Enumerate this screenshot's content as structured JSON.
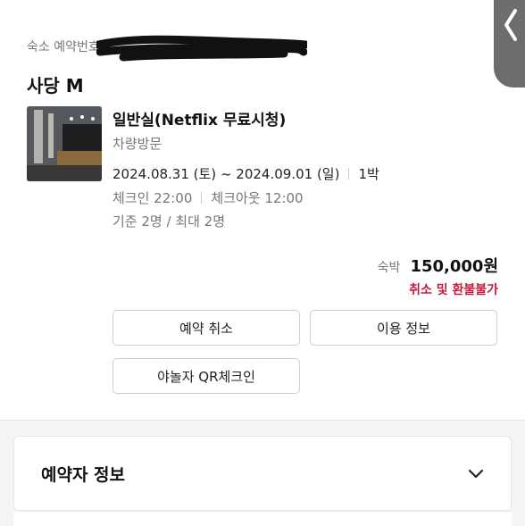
{
  "reservation": {
    "number_label": "숙소 예약번호",
    "hotel_name": "사당 M",
    "room_name": "일반실(Netflix 무료시청)",
    "visit_type": "차량방문",
    "checkin_date": "2024.08.31 (토)",
    "date_separator": "~",
    "checkout_date": "2024.09.01 (일)",
    "nights": "1박",
    "checkin_time": "체크인 22:00",
    "checkout_time": "체크아웃 12:00",
    "capacity": "기준 2명 / 최대 2명",
    "price_label": "숙박",
    "price": "150,000원",
    "cancel_policy": "취소 및 환불불가"
  },
  "actions": {
    "cancel_label": "예약 취소",
    "info_label": "이용 정보",
    "qr_label": "야놀자 QR체크인"
  },
  "booker": {
    "title": "예약자 정보"
  },
  "colors": {
    "accent_red": "#c8193a",
    "overlay": "#6d6d6d"
  },
  "icons": {
    "back": "chevron-left-icon",
    "expand": "chevron-down-icon"
  }
}
